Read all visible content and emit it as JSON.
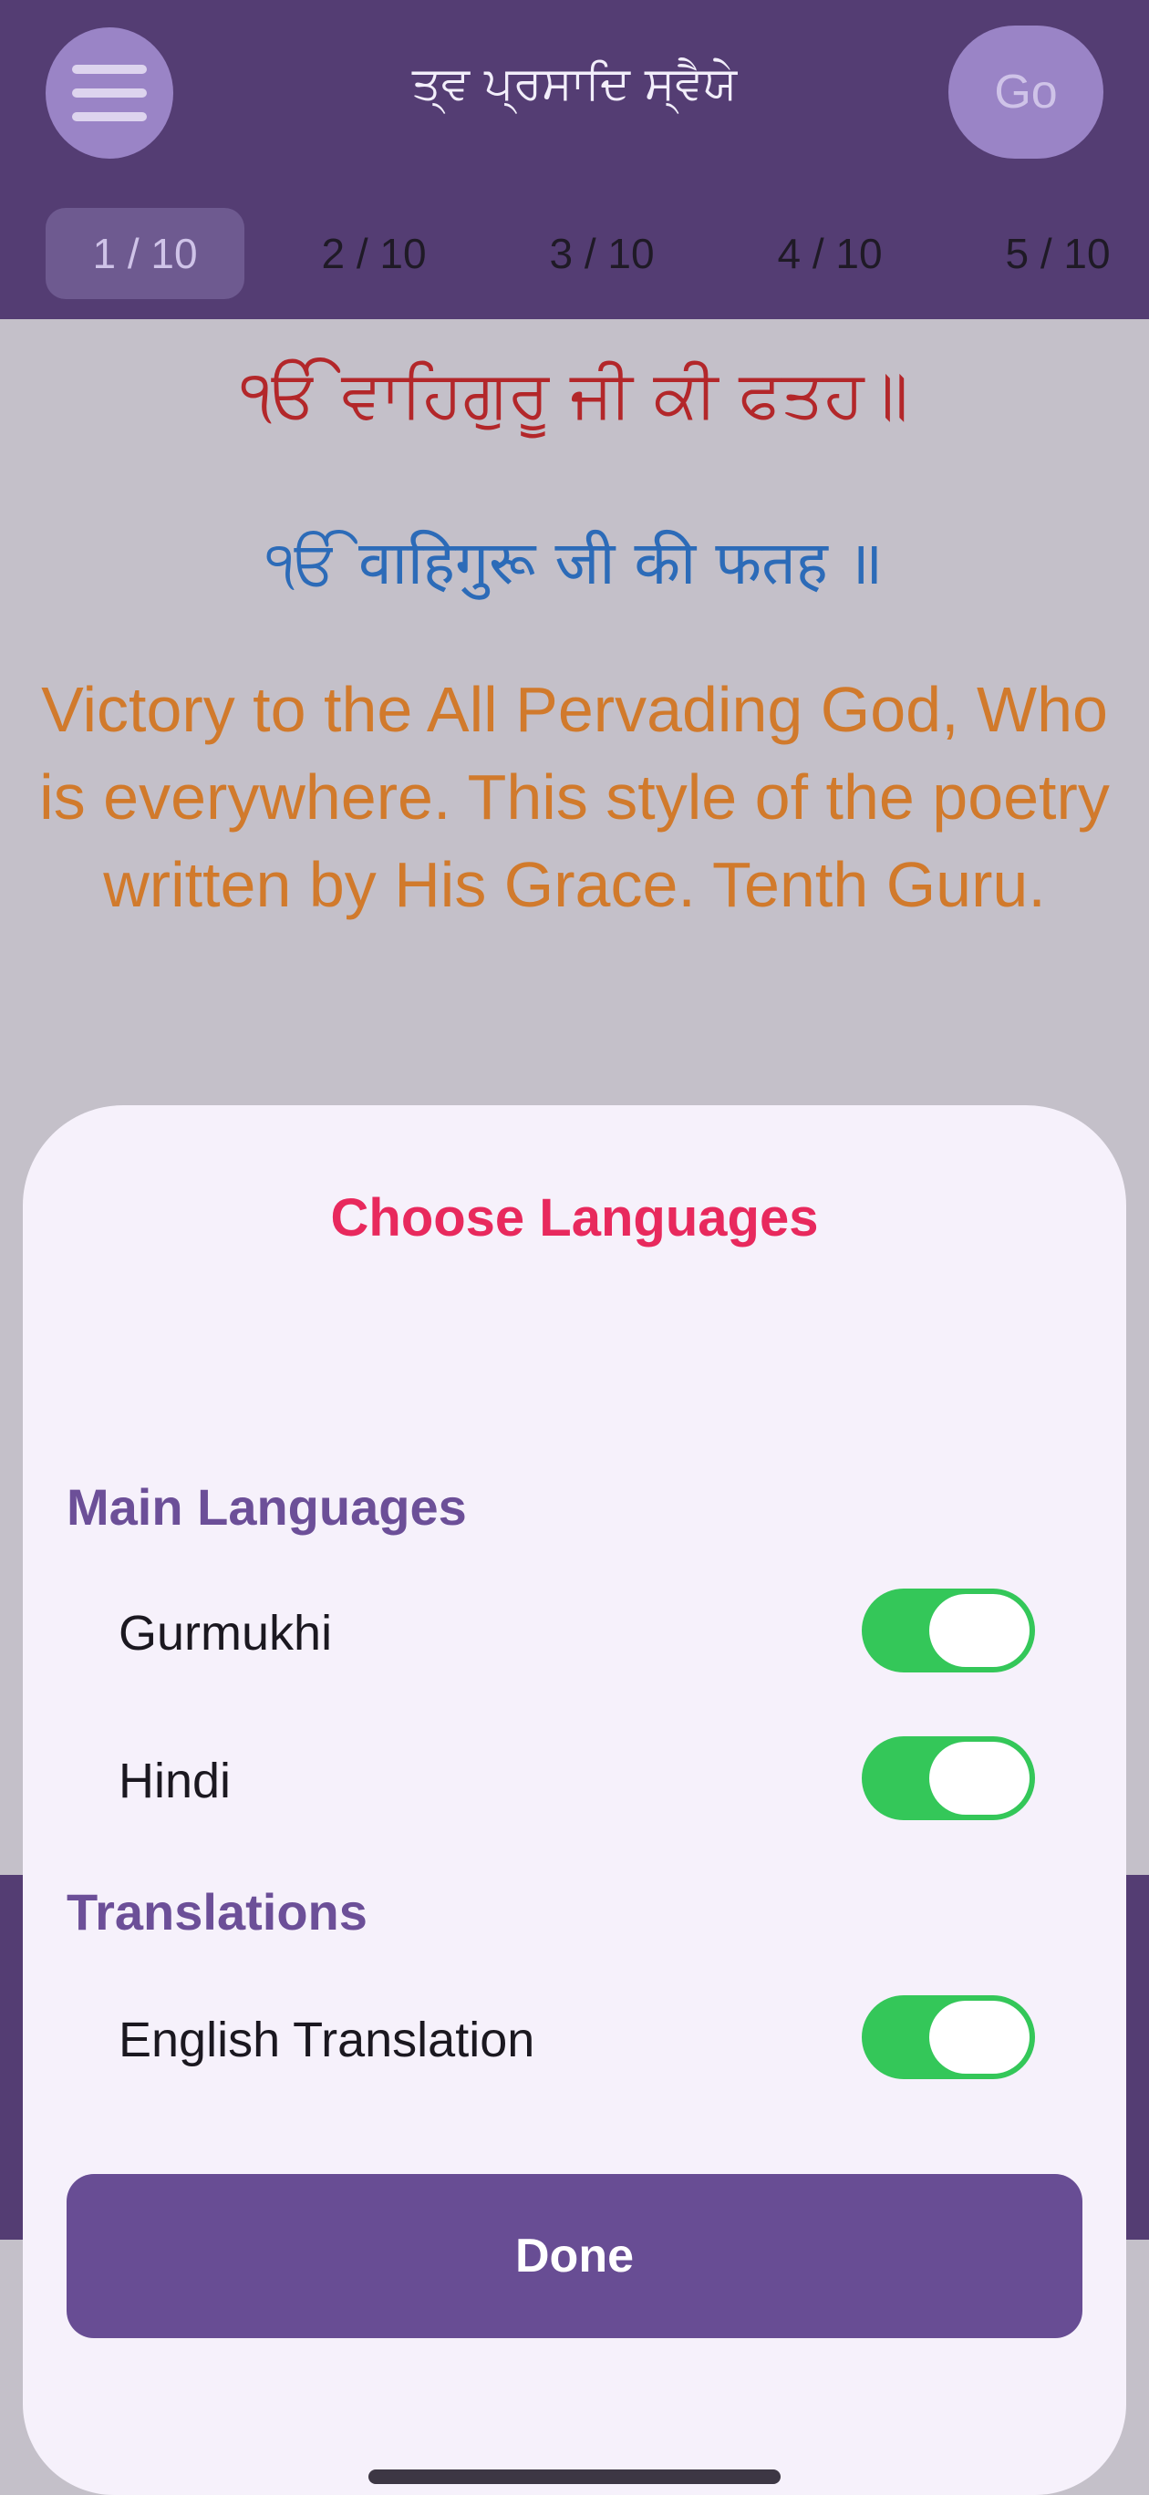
{
  "header": {
    "title": "ਤ੍ਵ ਪ੍ਰਸਾਦਿ ਸ੍ਵੈਯੇ",
    "go_label": "Go"
  },
  "tabs": [
    "1 / 10",
    "2 / 10",
    "3 / 10",
    "4 / 10",
    "5 / 10"
  ],
  "active_tab_index": 0,
  "verse": {
    "gurmukhi": "ੴ ਵਾਹਿਗੁਰੂ ਜੀ ਕੀ ਫਤਹ॥",
    "hindi": "ੴ वाहिगुरू जी की फतह ॥",
    "english": "Victory to the All Pervading God, Who is everywhere. This style of the poetry written by His Grace. Tenth Guru."
  },
  "sheet": {
    "title": "Choose Languages",
    "main_section": "Main Languages",
    "gurmukhi_label": "Gurmukhi",
    "gurmukhi_on": true,
    "hindi_label": "Hindi",
    "hindi_on": true,
    "translations_section": "Translations",
    "english_label": "English Translation",
    "english_on": true,
    "done_label": "Done"
  },
  "colors": {
    "header_bg": "#543d73",
    "accent_title": "#e8295d",
    "section_heading": "#6c4f98",
    "toggle_on": "#34c759",
    "gurmukhi_text": "#b3272a",
    "hindi_text": "#2c6bb8",
    "english_text": "#d17a2c",
    "done_button": "#684d94"
  }
}
